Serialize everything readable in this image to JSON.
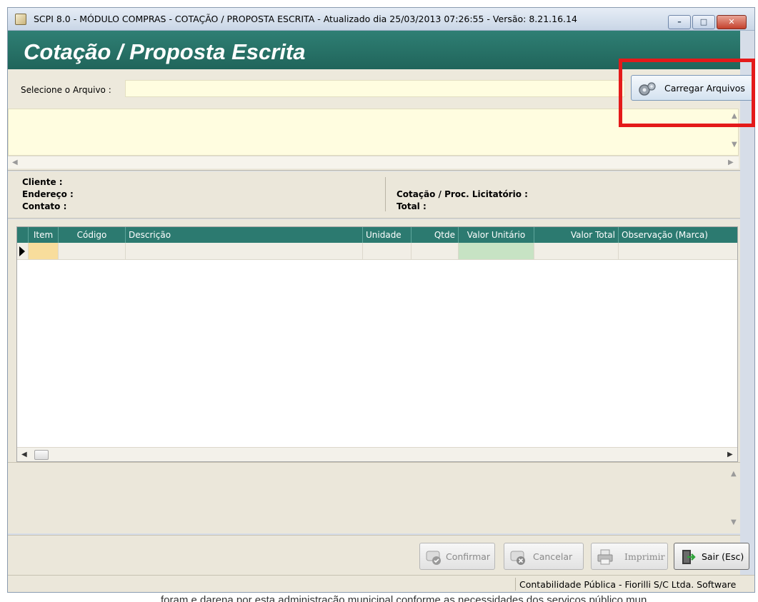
{
  "window": {
    "title": "SCPI 8.0 - MÓDULO COMPRAS - COTAÇÃO / PROPOSTA ESCRITA - Atualizado dia 25/03/2013 07:26:55 - Versão: 8.21.16.14",
    "controls": {
      "minimize": "–",
      "maximize": "□",
      "close": "✕"
    }
  },
  "header": {
    "title": "Cotação / Proposta Escrita"
  },
  "file_select": {
    "label": "Selecione o Arquivo :",
    "value": "",
    "load_button": "Carregar Arquivos",
    "load_icon": "gears-icon"
  },
  "log": {
    "content": ""
  },
  "info": {
    "cliente_label": "Cliente :",
    "endereco_label": "Endereço :",
    "contato_label": "Contato :",
    "cotacao_label": "Cotação / Proc. Licitatório :",
    "total_label": "Total :"
  },
  "grid": {
    "columns": [
      "Item",
      "Código",
      "Descrição",
      "Unidade",
      "Qtde",
      "Valor Unitário",
      "Valor Total",
      "Observação (Marca)"
    ],
    "rows": []
  },
  "actions": {
    "confirm": "Confirmar",
    "cancel": "Cancelar",
    "print": "Imprimir",
    "exit": "Sair (Esc)"
  },
  "status_bar": {
    "text": "Contabilidade Pública - Fiorilli S/C Ltda. Software"
  },
  "background_text": "foram e darena por esta administracão municipal conforme as necessidades dos servicos público mun",
  "colors": {
    "header_band": "#2f7f74",
    "grid_header": "#2c7a70",
    "input_bg": "#fffde0",
    "highlight": "#e41a1a"
  }
}
